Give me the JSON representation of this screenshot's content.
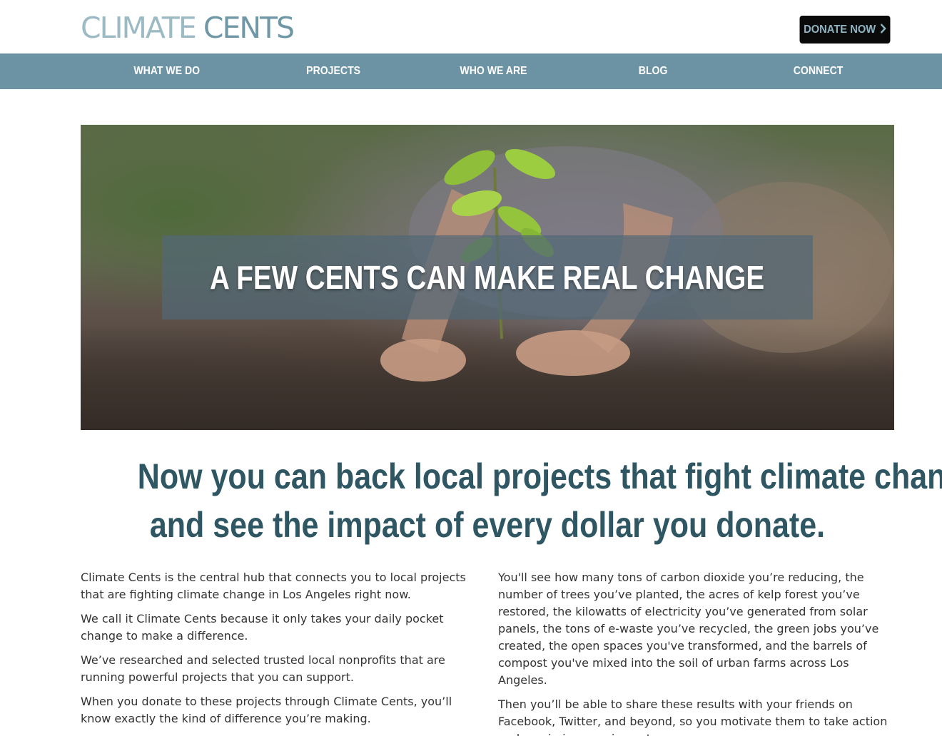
{
  "header": {
    "logo_word1": "CLIMATE",
    "logo_word2": "CENTS",
    "donate_label": "DONATE NOW",
    "donate_icon": "chevron-right-icon"
  },
  "nav": {
    "items": [
      {
        "label": "WHAT WE DO"
      },
      {
        "label": "PROJECTS"
      },
      {
        "label": "WHO WE ARE"
      },
      {
        "label": "BLOG"
      },
      {
        "label": "CONNECT"
      }
    ]
  },
  "hero": {
    "title": "A FEW CENTS CAN MAKE REAL CHANGE"
  },
  "main": {
    "headline_line1": "Now you can back local projects that fight climate change",
    "headline_line2": "and see the impact of every dollar you donate.",
    "left_paragraphs": [
      "Climate Cents is the central hub that connects you to local projects that are fighting climate change in Los Angeles right now.",
      "We call it Climate Cents because it only takes your daily pocket change to make a difference.",
      "We’ve researched and selected trusted local nonprofits that are running powerful projects that you can support.",
      "When you donate to these projects through Climate Cents, you’ll know exactly the kind of difference you’re making."
    ],
    "right_paragraphs": [
      "You'll see how many tons of carbon dioxide you’re reducing, the number of trees you’ve planted, the acres of kelp forest you’ve restored, the kilowatts of electricity you’ve generated from solar panels, the tons of e-waste you’ve recycled, the green jobs you’ve created, the open spaces you've transformed, and the barrels of compost you've mixed into the soil of urban farms across Los Angeles.",
      "Then you’ll be able to share these results with your friends on Facebook, Twitter, and beyond, so you motivate them to take action and maximize your impact."
    ]
  },
  "colors": {
    "nav_bg": "#6b93a4",
    "headline": "#2f5663",
    "logo_light": "#9cbac4",
    "logo_dark": "#6f97a6",
    "donate_bg": "#0a0a0a",
    "donate_text": "#8fb4c3"
  }
}
